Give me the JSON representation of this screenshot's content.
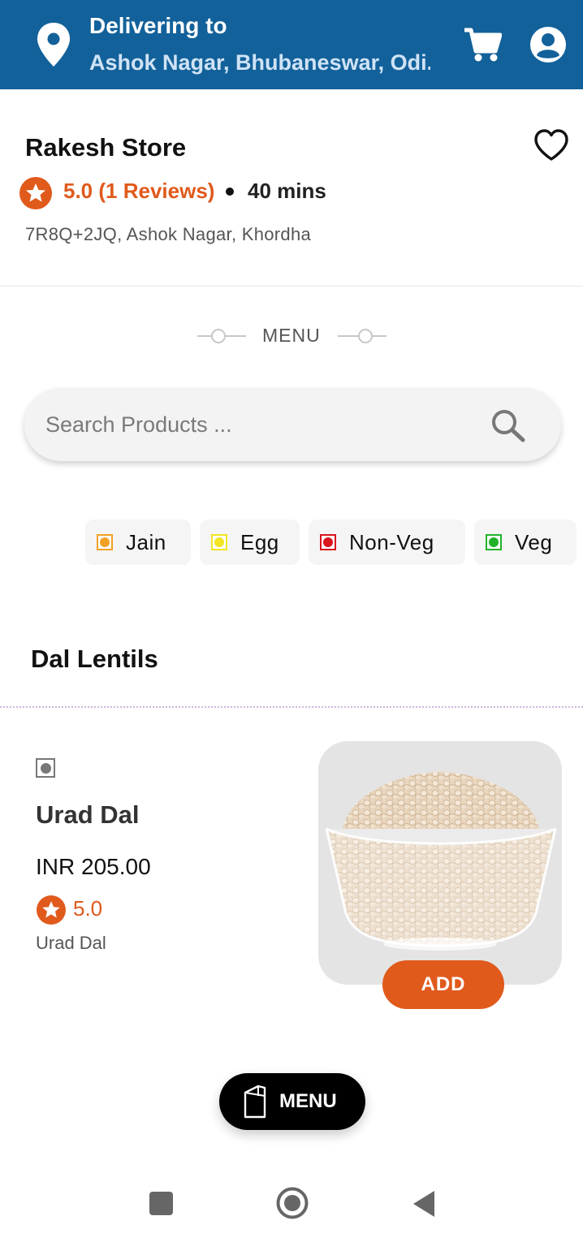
{
  "header": {
    "title": "Delivering to",
    "address": "Ashok Nagar, Bhubaneswar, Odi..."
  },
  "store": {
    "name": "Rakesh Store",
    "rating": "5.0 (1 Reviews)",
    "eta": "40 mins",
    "address": "7R8Q+2JQ, Ashok Nagar, Khordha"
  },
  "menu": {
    "heading": "MENU"
  },
  "search": {
    "placeholder": "Search Products ..."
  },
  "filters": [
    {
      "label": "Jain",
      "color": "#f2a126"
    },
    {
      "label": "Egg",
      "color": "#f2e623"
    },
    {
      "label": "Non-Veg",
      "color": "#d9141d"
    },
    {
      "label": "Veg",
      "color": "#22b22a"
    }
  ],
  "category": {
    "title": "Dal Lentils"
  },
  "product": {
    "name": "Urad Dal",
    "price": "INR 205.00",
    "rating": "5.0",
    "description": "Urad Dal",
    "add_label": "ADD"
  },
  "fab": {
    "label": "MENU"
  },
  "colors": {
    "header_bg": "#13619a",
    "accent": "#e05a1c"
  }
}
